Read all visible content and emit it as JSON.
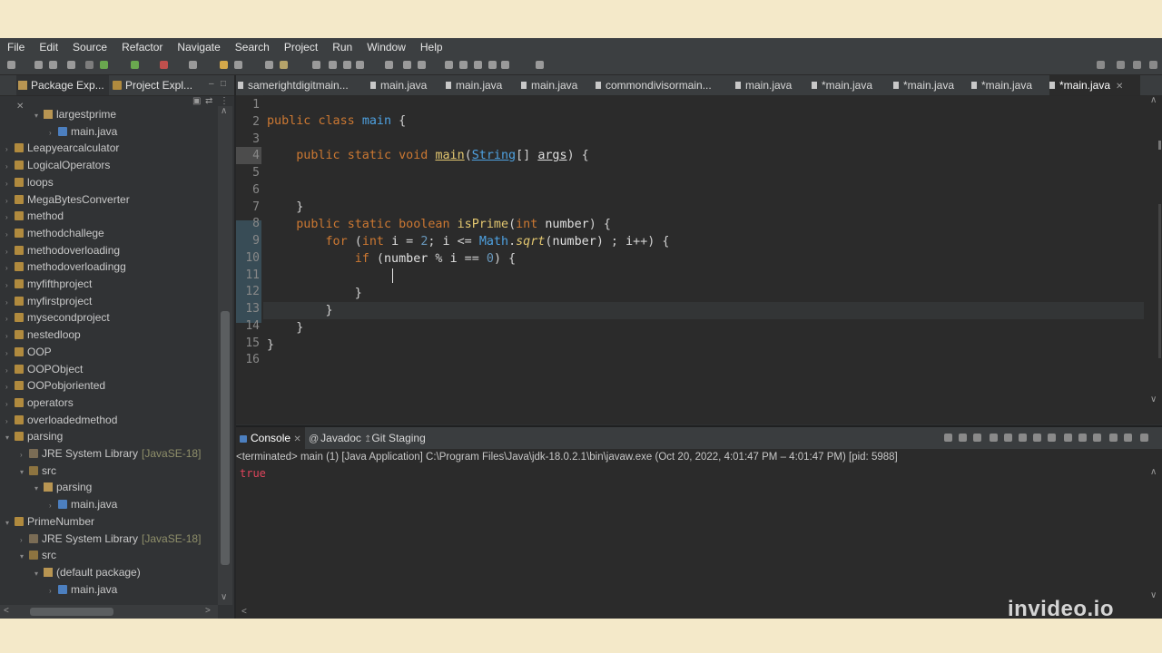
{
  "menu": [
    "File",
    "Edit",
    "Source",
    "Refactor",
    "Navigate",
    "Search",
    "Project",
    "Run",
    "Window",
    "Help"
  ],
  "explorer": {
    "tab_active": "Package Exp...",
    "tab_other": "Project Expl...",
    "tree": [
      {
        "label": "largestprime",
        "kind": "pkg",
        "indent": 3,
        "twisty": "v"
      },
      {
        "label": "main.java",
        "kind": "file",
        "indent": 4,
        "twisty": ">"
      },
      {
        "label": "Leapyearcalculator",
        "kind": "folder",
        "indent": 1,
        "twisty": ">"
      },
      {
        "label": "LogicalOperators",
        "kind": "folder",
        "indent": 1,
        "twisty": ">"
      },
      {
        "label": "loops",
        "kind": "folder",
        "indent": 1,
        "twisty": ">"
      },
      {
        "label": "MegaBytesConverter",
        "kind": "folder",
        "indent": 1,
        "twisty": ">"
      },
      {
        "label": "method",
        "kind": "folder",
        "indent": 1,
        "twisty": ">"
      },
      {
        "label": "methodchallege",
        "kind": "folder",
        "indent": 1,
        "twisty": ">"
      },
      {
        "label": "methodoverloading",
        "kind": "folder",
        "indent": 1,
        "twisty": ">"
      },
      {
        "label": "methodoverloadingg",
        "kind": "folder",
        "indent": 1,
        "twisty": ">"
      },
      {
        "label": "myfifthproject",
        "kind": "folder",
        "indent": 1,
        "twisty": ">"
      },
      {
        "label": "myfirstproject",
        "kind": "folder",
        "indent": 1,
        "twisty": ">"
      },
      {
        "label": "mysecondproject",
        "kind": "folder",
        "indent": 1,
        "twisty": ">"
      },
      {
        "label": "nestedloop",
        "kind": "folder",
        "indent": 1,
        "twisty": ">"
      },
      {
        "label": "OOP",
        "kind": "folder",
        "indent": 1,
        "twisty": ">"
      },
      {
        "label": "OOPObject",
        "kind": "folder",
        "indent": 1,
        "twisty": ">"
      },
      {
        "label": "OOPobjoriented",
        "kind": "folder",
        "indent": 1,
        "twisty": ">"
      },
      {
        "label": "operators",
        "kind": "folder",
        "indent": 1,
        "twisty": ">"
      },
      {
        "label": "overloadedmethod",
        "kind": "folder",
        "indent": 1,
        "twisty": ">"
      },
      {
        "label": "parsing",
        "kind": "folder",
        "indent": 1,
        "twisty": "v"
      },
      {
        "label": "JRE System Library",
        "suffix": "[JavaSE-18]",
        "kind": "lib",
        "indent": 2,
        "twisty": ">"
      },
      {
        "label": "src",
        "kind": "srcf",
        "indent": 2,
        "twisty": "v"
      },
      {
        "label": "parsing",
        "kind": "pkg",
        "indent": 3,
        "twisty": "v"
      },
      {
        "label": "main.java",
        "kind": "file",
        "indent": 4,
        "twisty": ">"
      },
      {
        "label": "PrimeNumber",
        "kind": "folder",
        "indent": 1,
        "twisty": "v"
      },
      {
        "label": "JRE System Library",
        "suffix": "[JavaSE-18]",
        "kind": "lib",
        "indent": 2,
        "twisty": ">"
      },
      {
        "label": "src",
        "kind": "srcf",
        "indent": 2,
        "twisty": "v"
      },
      {
        "label": "(default package)",
        "kind": "pkg",
        "indent": 3,
        "twisty": "v"
      },
      {
        "label": "main.java",
        "kind": "file",
        "indent": 4,
        "twisty": ">"
      }
    ]
  },
  "editor": {
    "tabs": [
      {
        "label": "samerightdigitmain...",
        "active": false
      },
      {
        "label": "main.java",
        "active": false
      },
      {
        "label": "main.java",
        "active": false
      },
      {
        "label": "main.java",
        "active": false
      },
      {
        "label": "commondivisormain...",
        "active": false
      },
      {
        "label": "main.java",
        "active": false
      },
      {
        "label": "*main.java",
        "active": false
      },
      {
        "label": "*main.java",
        "active": false
      },
      {
        "label": "*main.java",
        "active": false
      },
      {
        "label": "*main.java",
        "active": true
      }
    ],
    "line_numbers": [
      "1",
      "2",
      "3",
      "4",
      "5",
      "6",
      "7",
      "8",
      "9",
      "10",
      "11",
      "12",
      "13",
      "14",
      "15",
      "16"
    ]
  },
  "console": {
    "tabs": [
      "Console",
      "Javadoc",
      "Git Staging"
    ],
    "status": "<terminated> main (1) [Java Application] C:\\Program Files\\Java\\jdk-18.0.2.1\\bin\\javaw.exe  (Oct 20, 2022, 4:01:47 PM – 4:01:47 PM) [pid: 5988]",
    "output": "true"
  },
  "watermark": "invideo.io"
}
